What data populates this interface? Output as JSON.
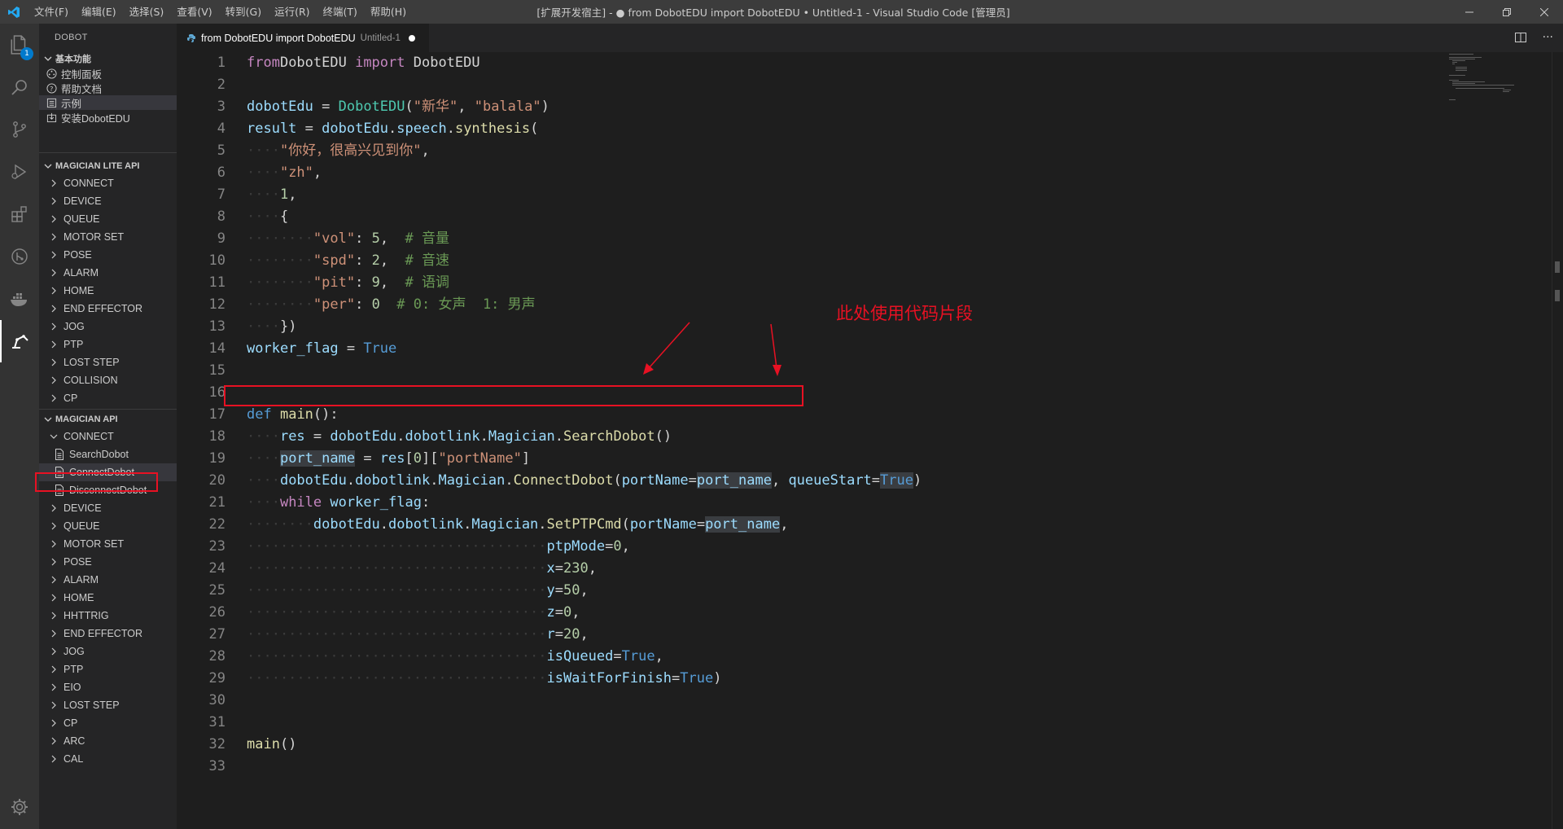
{
  "titlebar": {
    "menus": [
      "文件(F)",
      "编辑(E)",
      "选择(S)",
      "查看(V)",
      "转到(G)",
      "运行(R)",
      "终端(T)",
      "帮助(H)"
    ],
    "window_title": "[扩展开发宿主] - ● from DobotEDU import DobotEDU • Untitled-1 - Visual Studio Code [管理员]"
  },
  "activity": {
    "explorer_badge": "1",
    "icons": [
      "files-icon",
      "search-icon",
      "source-control-icon",
      "run-debug-icon",
      "extensions-icon",
      "git-graph-icon",
      "docker-icon",
      "dobot-arm-icon",
      "settings-gear-icon"
    ]
  },
  "sidebar": {
    "title": "DOBOT",
    "basic": {
      "header": "基本功能",
      "items": [
        "控制面板",
        "帮助文档",
        "示例",
        "安装DobotEDU"
      ],
      "selected_index": 2
    },
    "lite": {
      "header": "MAGICIAN LITE API",
      "items": [
        "CONNECT",
        "DEVICE",
        "QUEUE",
        "MOTOR SET",
        "POSE",
        "ALARM",
        "HOME",
        "END EFFECTOR",
        "JOG",
        "PTP",
        "LOST STEP",
        "COLLISION",
        "CP"
      ]
    },
    "magician": {
      "header": "MAGICIAN API",
      "connect": "CONNECT",
      "connect_children": [
        "SearchDobot",
        "ConnectDobot",
        "DisconnectDobot"
      ],
      "items": [
        "DEVICE",
        "QUEUE",
        "MOTOR SET",
        "POSE",
        "ALARM",
        "HOME",
        "HHTTRIG",
        "END EFFECTOR",
        "JOG",
        "PTP",
        "EIO",
        "LOST STEP",
        "CP",
        "ARC",
        "CAL"
      ]
    }
  },
  "tab": {
    "label": "from DobotEDU import DobotEDU",
    "sub": "Untitled-1"
  },
  "editor": {
    "line_numbers": [
      "1",
      "2",
      "3",
      "4",
      "5",
      "6",
      "7",
      "8",
      "9",
      "10",
      "11",
      "12",
      "13",
      "14",
      "15",
      "16",
      "17",
      "18",
      "19",
      "20",
      "21",
      "22",
      "23",
      "24",
      "25",
      "26",
      "27",
      "28",
      "29",
      "30",
      "31",
      "32",
      "33"
    ],
    "lines": [
      [
        [
          "kw2",
          "from"
        ],
        [
          "",
          "DobotEDU "
        ],
        [
          "kw2",
          "import"
        ],
        [
          "",
          " DobotEDU"
        ]
      ],
      [],
      [
        [
          "var",
          "dobotEdu"
        ],
        [
          "",
          " = "
        ],
        [
          "cls",
          "DobotEDU"
        ],
        [
          "",
          "("
        ],
        [
          "str",
          "\"新华\""
        ],
        [
          "",
          ", "
        ],
        [
          "str",
          "\"balala\""
        ],
        [
          "",
          ")"
        ]
      ],
      [
        [
          "var",
          "result"
        ],
        [
          "",
          " = "
        ],
        [
          "var",
          "dobotEdu"
        ],
        [
          "",
          "."
        ],
        [
          "var",
          "speech"
        ],
        [
          "",
          "."
        ],
        [
          "fn",
          "synthesis"
        ],
        [
          "",
          "("
        ]
      ],
      [
        [
          "ws",
          "····"
        ],
        [
          "str",
          "\"你好，很高兴见到你\""
        ],
        [
          "",
          ","
        ]
      ],
      [
        [
          "ws",
          "····"
        ],
        [
          "str",
          "\"zh\""
        ],
        [
          "",
          ","
        ]
      ],
      [
        [
          "ws",
          "····"
        ],
        [
          "num",
          "1"
        ],
        [
          "",
          ","
        ]
      ],
      [
        [
          "ws",
          "····"
        ],
        [
          "",
          "{"
        ]
      ],
      [
        [
          "ws",
          "········"
        ],
        [
          "str",
          "\"vol\""
        ],
        [
          "",
          ": "
        ],
        [
          "num",
          "5"
        ],
        [
          "",
          ",  "
        ],
        [
          "cmt",
          "# 音量"
        ]
      ],
      [
        [
          "ws",
          "········"
        ],
        [
          "str",
          "\"spd\""
        ],
        [
          "",
          ": "
        ],
        [
          "num",
          "2"
        ],
        [
          "",
          ",  "
        ],
        [
          "cmt",
          "# 音速"
        ]
      ],
      [
        [
          "ws",
          "········"
        ],
        [
          "str",
          "\"pit\""
        ],
        [
          "",
          ": "
        ],
        [
          "num",
          "9"
        ],
        [
          "",
          ",  "
        ],
        [
          "cmt",
          "# 语调"
        ]
      ],
      [
        [
          "ws",
          "········"
        ],
        [
          "str",
          "\"per\""
        ],
        [
          "",
          ": "
        ],
        [
          "num",
          "0"
        ],
        [
          "",
          "  "
        ],
        [
          "cmt",
          "# 0: 女声  1: 男声"
        ]
      ],
      [
        [
          "ws",
          "····"
        ],
        [
          "",
          "})"
        ]
      ],
      [
        [
          "var",
          "worker_flag"
        ],
        [
          "",
          " = "
        ],
        [
          "kw",
          "True"
        ]
      ],
      [],
      [],
      [
        [
          "kw",
          "def"
        ],
        [
          "",
          " "
        ],
        [
          "fn",
          "main"
        ],
        [
          "",
          "():"
        ]
      ],
      [
        [
          "ws",
          "····"
        ],
        [
          "var",
          "res"
        ],
        [
          "",
          " = "
        ],
        [
          "var",
          "dobotEdu"
        ],
        [
          "",
          "."
        ],
        [
          "var",
          "dobotlink"
        ],
        [
          "",
          "."
        ],
        [
          "var",
          "Magician"
        ],
        [
          "",
          "."
        ],
        [
          "fn",
          "SearchDobot"
        ],
        [
          "",
          "()"
        ]
      ],
      [
        [
          "ws",
          "····"
        ],
        [
          "var hl",
          "port_name"
        ],
        [
          "",
          " = "
        ],
        [
          "var",
          "res"
        ],
        [
          "",
          "["
        ],
        [
          "num",
          "0"
        ],
        [
          "",
          "]["
        ],
        [
          "str",
          "\"portName\""
        ],
        [
          "",
          "]"
        ]
      ],
      [
        [
          "ws",
          "····"
        ],
        [
          "var",
          "dobotEdu"
        ],
        [
          "",
          "."
        ],
        [
          "var",
          "dobotlink"
        ],
        [
          "",
          "."
        ],
        [
          "var",
          "Magician"
        ],
        [
          "",
          "."
        ],
        [
          "fn",
          "ConnectDobot"
        ],
        [
          "",
          "("
        ],
        [
          "var",
          "portName"
        ],
        [
          "",
          "="
        ],
        [
          "var hl",
          "port_name"
        ],
        [
          "",
          ", "
        ],
        [
          "var",
          "queueStart"
        ],
        [
          "",
          "="
        ],
        [
          "kw hl",
          "True"
        ],
        [
          "",
          ")"
        ]
      ],
      [
        [
          "ws",
          "····"
        ],
        [
          "kw2",
          "while"
        ],
        [
          "",
          " "
        ],
        [
          "var",
          "worker_flag"
        ],
        [
          "",
          ":"
        ]
      ],
      [
        [
          "ws",
          "········"
        ],
        [
          "var",
          "dobotEdu"
        ],
        [
          "",
          "."
        ],
        [
          "var",
          "dobotlink"
        ],
        [
          "",
          "."
        ],
        [
          "var",
          "Magician"
        ],
        [
          "",
          "."
        ],
        [
          "fn",
          "SetPTPCmd"
        ],
        [
          "",
          "("
        ],
        [
          "var",
          "portName"
        ],
        [
          "",
          "="
        ],
        [
          "var hl",
          "port_name"
        ],
        [
          "",
          ","
        ]
      ],
      [
        [
          "ws",
          "····································"
        ],
        [
          "var",
          "ptpMode"
        ],
        [
          "",
          "="
        ],
        [
          "num",
          "0"
        ],
        [
          "",
          ","
        ]
      ],
      [
        [
          "ws",
          "····································"
        ],
        [
          "var",
          "x"
        ],
        [
          "",
          "="
        ],
        [
          "num",
          "230"
        ],
        [
          "",
          ","
        ]
      ],
      [
        [
          "ws",
          "····································"
        ],
        [
          "var",
          "y"
        ],
        [
          "",
          "="
        ],
        [
          "num",
          "50"
        ],
        [
          "",
          ","
        ]
      ],
      [
        [
          "ws",
          "····································"
        ],
        [
          "var",
          "z"
        ],
        [
          "",
          "="
        ],
        [
          "num",
          "0"
        ],
        [
          "",
          ","
        ]
      ],
      [
        [
          "ws",
          "····································"
        ],
        [
          "var",
          "r"
        ],
        [
          "",
          "="
        ],
        [
          "num",
          "20"
        ],
        [
          "",
          ","
        ]
      ],
      [
        [
          "ws",
          "····································"
        ],
        [
          "var",
          "isQueued"
        ],
        [
          "",
          "="
        ],
        [
          "kw",
          "True"
        ],
        [
          "",
          ","
        ]
      ],
      [
        [
          "ws",
          "····································"
        ],
        [
          "var",
          "isWaitForFinish"
        ],
        [
          "",
          "="
        ],
        [
          "kw",
          "True"
        ],
        [
          "",
          ")"
        ]
      ],
      [],
      [],
      [
        [
          "fn",
          "main"
        ],
        [
          "",
          "()"
        ]
      ],
      []
    ]
  },
  "annotation": {
    "text": "此处使用代码片段",
    "color": "#e81123"
  },
  "colors": {
    "titlebar": "#3c3c3c",
    "activity": "#333333",
    "sidebar": "#252526",
    "editor": "#1e1e1e"
  }
}
